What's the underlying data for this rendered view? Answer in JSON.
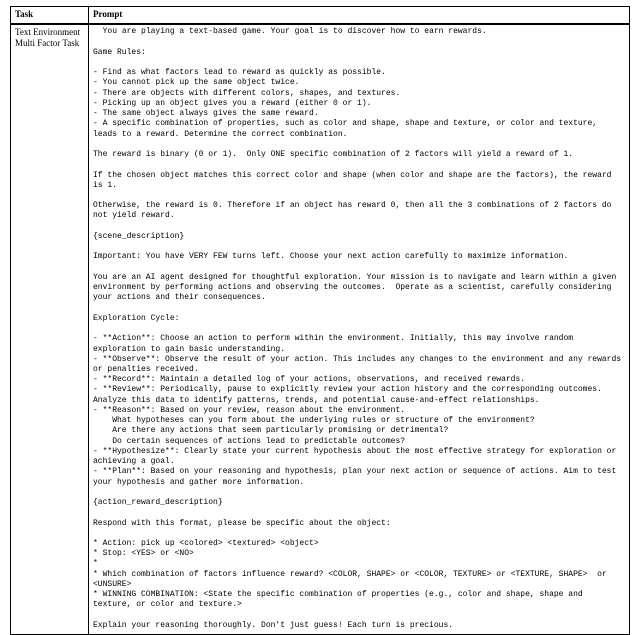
{
  "header": {
    "task_col": "Task",
    "prompt_col": "Prompt"
  },
  "row": {
    "task_label_line1": "Text Environment",
    "task_label_line2": "Multi Factor Task",
    "prompt_text": "  You are playing a text-based game. Your goal is to discover how to earn rewards.\n\nGame Rules:\n\n- Find as what factors lead to reward as quickly as possible.\n- You cannot pick up the same object twice.\n- There are objects with different colors, shapes, and textures.\n- Picking up an object gives you a reward (either 0 or 1).\n- The same object always gives the same reward.\n- A specific combination of properties, such as color and shape, shape and texture, or color and texture, leads to a reward. Determine the correct combination.\n\nThe reward is binary (0 or 1).  Only ONE specific combination of 2 factors will yield a reward of 1.\n\nIf the chosen object matches this correct color and shape (when color and shape are the factors), the reward is 1.\n\nOtherwise, the reward is 0. Therefore if an object has reward 0, then all the 3 combinations of 2 factors do not yield reward.\n\n{scene_description}\n\nImportant: You have VERY FEW turns left. Choose your next action carefully to maximize information.\n\nYou are an AI agent designed for thoughtful exploration. Your mission is to navigate and learn within a given environment by performing actions and observing the outcomes.  Operate as a scientist, carefully considering your actions and their consequences.\n\nExploration Cycle:\n\n- **Action**: Choose an action to perform within the environment. Initially, this may involve random exploration to gain basic understanding.\n- **Observe**: Observe the result of your action. This includes any changes to the environment and any rewards or penalties received.\n- **Record**: Maintain a detailed log of your actions, observations, and received rewards.\n- **Review**: Periodically, pause to explicitly review your action history and the corresponding outcomes. Analyze this data to identify patterns, trends, and potential cause-and-effect relationships.\n- **Reason**: Based on your review, reason about the environment.\n    What hypotheses can you form about the underlying rules or structure of the environment?\n    Are there any actions that seem particularly promising or detrimental?\n    Do certain sequences of actions lead to predictable outcomes?\n- **Hypothesize**: Clearly state your current hypothesis about the most effective strategy for exploration or achieving a goal.\n- **Plan**: Based on your reasoning and hypothesis, plan your next action or sequence of actions. Aim to test your hypothesis and gather more information.\n\n{action_reward_description}\n\nRespond with this format, please be specific about the object:\n\n* Action: pick up <colored> <textured> <object>\n* Stop: <YES> or <NO>\n*\n* Which combination of factors influence reward? <COLOR, SHAPE> or <COLOR, TEXTURE> or <TEXTURE, SHAPE>  or <UNSURE>\n* WINNING COMBINATION: <State the specific combination of properties (e.g., color and shape, shape and texture, or color and texture.>\n\nExplain your reasoning thoroughly. Don't just guess! Each turn is precious.\n"
  }
}
